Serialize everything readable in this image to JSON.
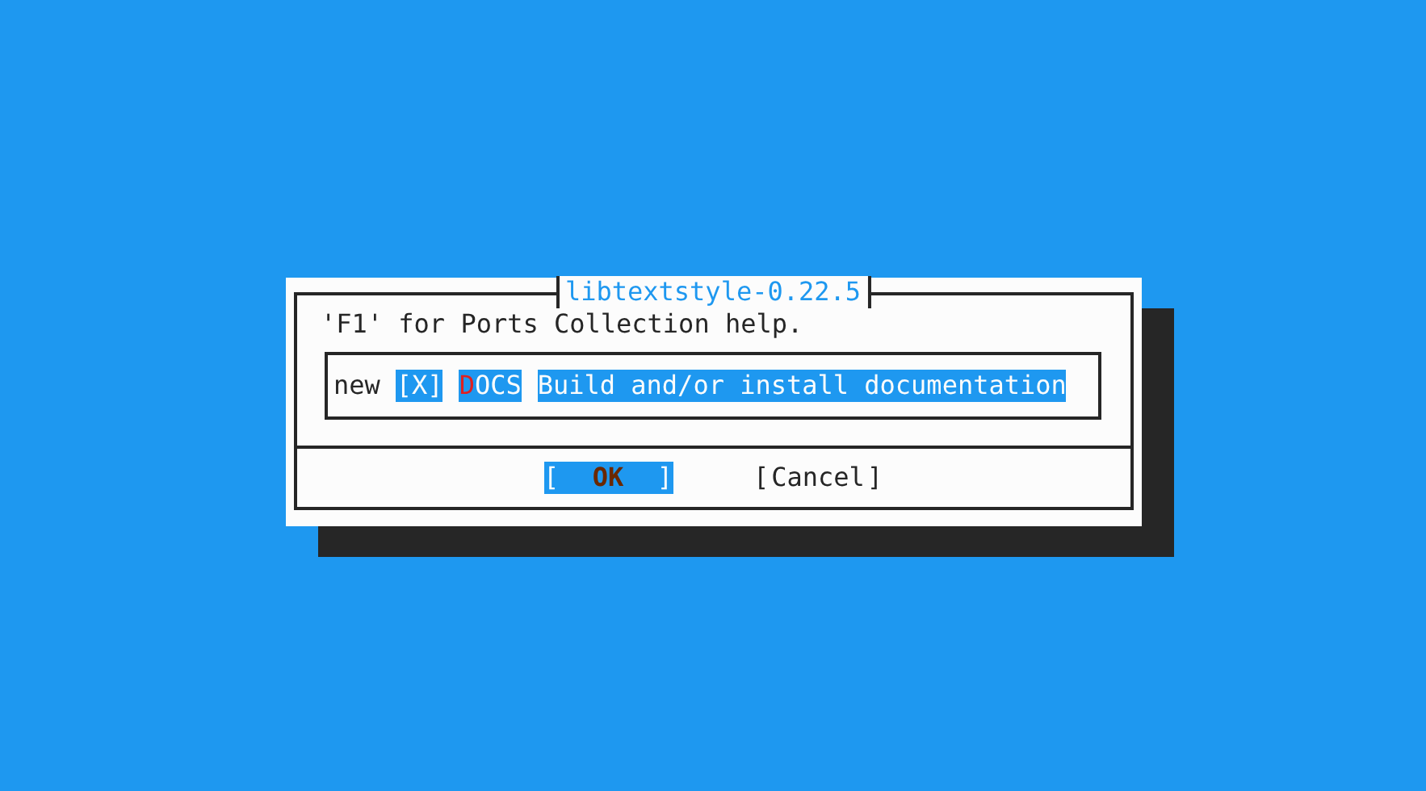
{
  "dialog": {
    "title": "libtextstyle-0.22.5",
    "hint": "'F1' for Ports Collection help.",
    "options": [
      {
        "tag": "new",
        "checkbox": "[X]",
        "name": "DOCS",
        "description": "Build and/or install documentation",
        "selected": true
      }
    ],
    "buttons": [
      {
        "open": "[",
        "label": "OK",
        "close": "]",
        "selected": true
      },
      {
        "open": "[",
        "label": "Cancel",
        "close": "]",
        "selected": false
      }
    ]
  }
}
